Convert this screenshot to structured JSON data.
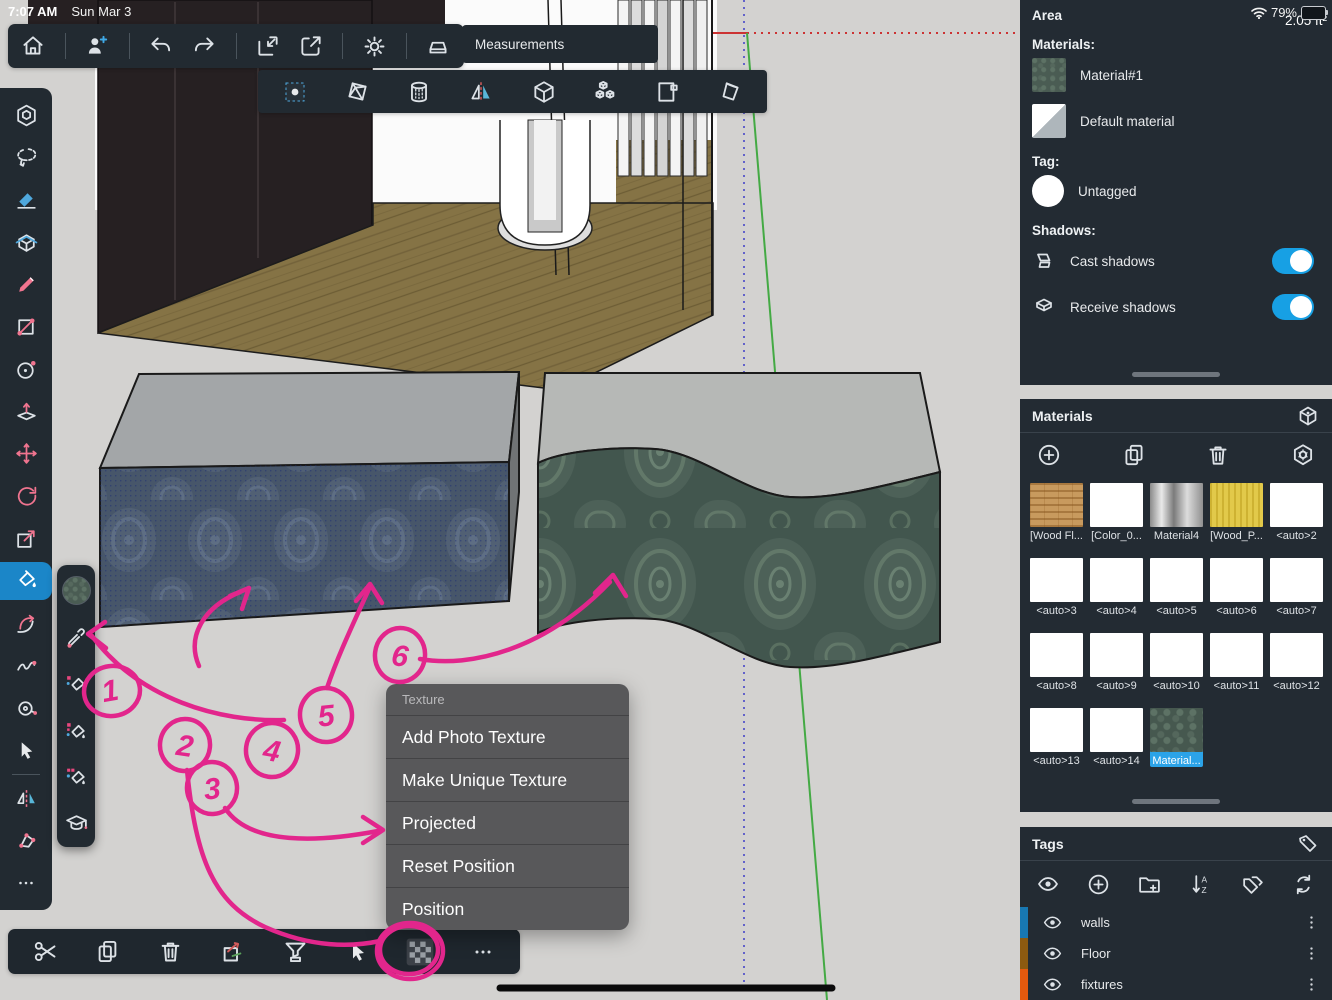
{
  "status": {
    "time": "7:07 AM",
    "date": "Sun Mar 3",
    "battery_pct": "79%"
  },
  "colors": {
    "accent_pink": "#e2268c",
    "selection_blue": "#2ba3e8",
    "toggle_on": "#17a0e4",
    "tag_walls": "#1878b2",
    "tag_floor": "#8c5a10",
    "tag_fixtures": "#e3590e",
    "panel_bg": "#232b33",
    "menu_bg": "#58585a"
  },
  "measurements": {
    "label": "Measurements"
  },
  "entity_panel": {
    "title": "Area",
    "area_value": "2.05 ft²",
    "materials_label": "Materials:",
    "materials": [
      {
        "name": "Material#1"
      },
      {
        "name": "Default material"
      }
    ],
    "tag_label": "Tag:",
    "tag_value": "Untagged",
    "shadows_label": "Shadows:",
    "cast_label": "Cast shadows",
    "receive_label": "Receive shadows"
  },
  "materials_panel": {
    "title": "Materials",
    "items": [
      {
        "label": "[Wood Fl..."
      },
      {
        "label": "[Color_0..."
      },
      {
        "label": "Material4"
      },
      {
        "label": "[Wood_P..."
      },
      {
        "label": "<auto>2"
      },
      {
        "label": "<auto>3"
      },
      {
        "label": "<auto>4"
      },
      {
        "label": "<auto>5"
      },
      {
        "label": "<auto>6"
      },
      {
        "label": "<auto>7"
      },
      {
        "label": "<auto>8"
      },
      {
        "label": "<auto>9"
      },
      {
        "label": "<auto>10"
      },
      {
        "label": "<auto>11"
      },
      {
        "label": "<auto>12"
      },
      {
        "label": "<auto>13"
      },
      {
        "label": "<auto>14"
      },
      {
        "label": "Material..."
      }
    ]
  },
  "tags_panel": {
    "title": "Tags",
    "rows": [
      {
        "label": "walls"
      },
      {
        "label": "Floor"
      },
      {
        "label": "fixtures"
      }
    ]
  },
  "context_menu": {
    "header": "Texture",
    "items": [
      "Add Photo Texture",
      "Make Unique Texture",
      "Projected",
      "Reset Position",
      "Position"
    ]
  },
  "annotations": {
    "numbers": [
      "1",
      "2",
      "3",
      "4",
      "5",
      "6"
    ]
  }
}
